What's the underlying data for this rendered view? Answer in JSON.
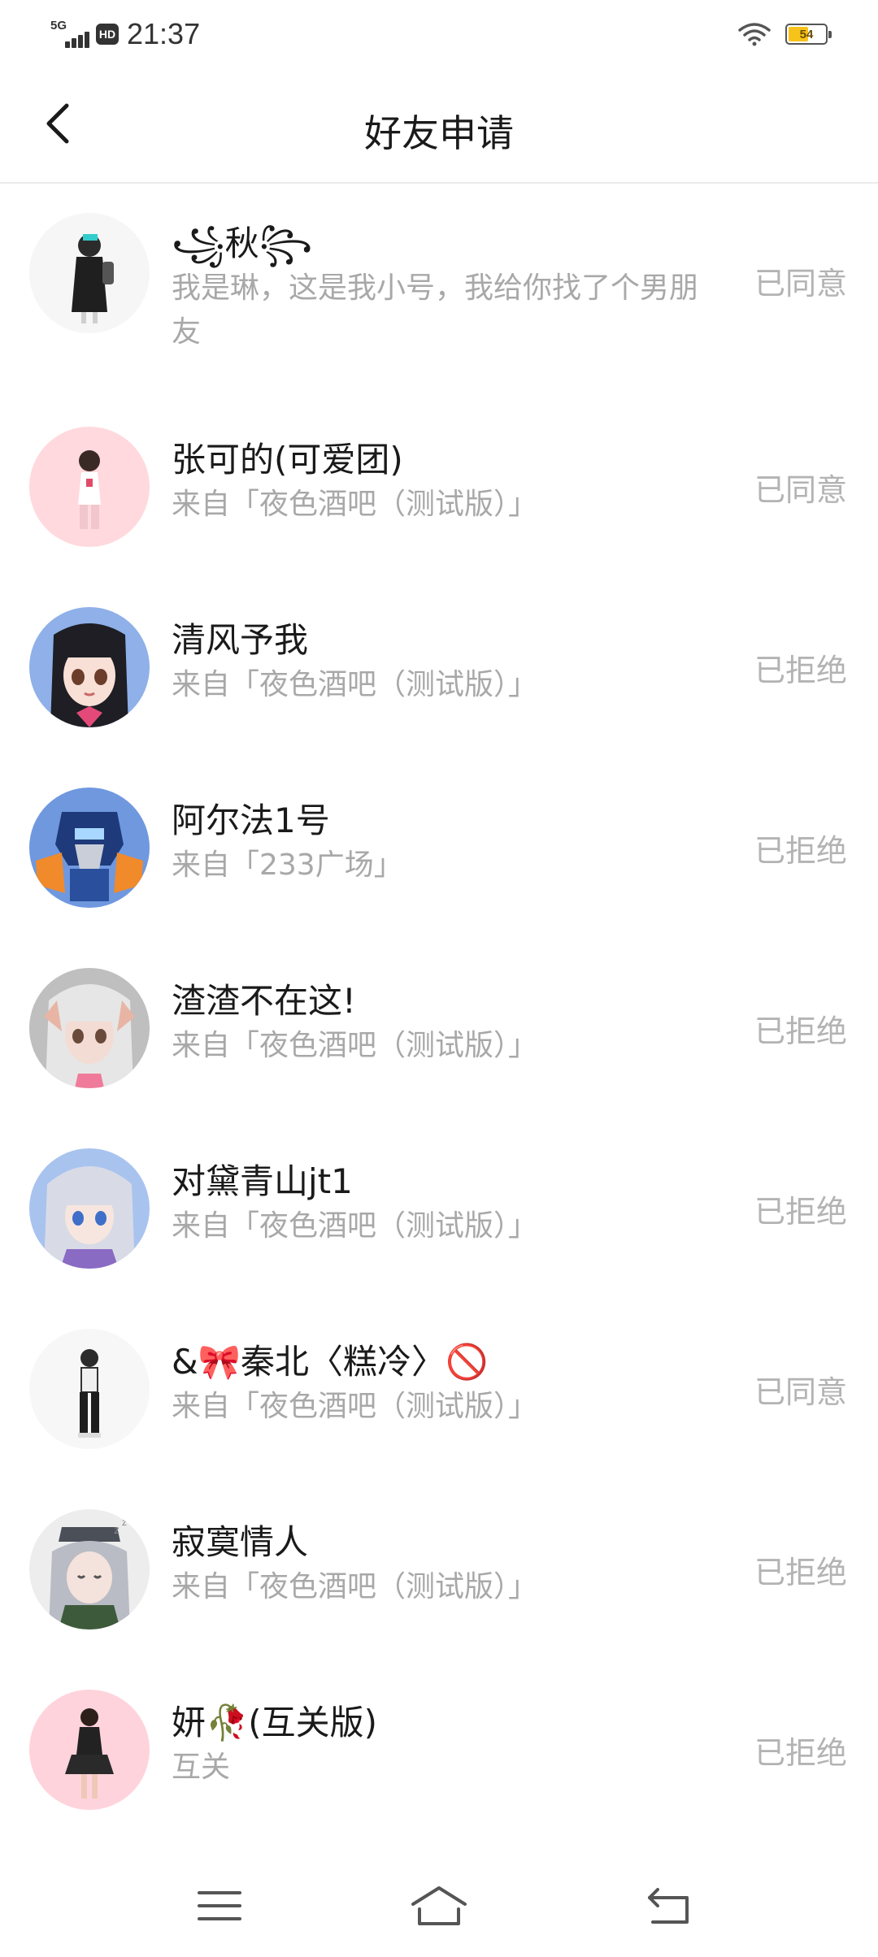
{
  "status_bar": {
    "network": "5G",
    "hd_label": "HD",
    "time": "21:37",
    "battery_level": "54",
    "battery_fraction": 0.54
  },
  "header": {
    "title": "好友申请"
  },
  "requests": [
    {
      "name": "꧁秋꧂",
      "message": "我是琳，这是我小号，我给你找了个男朋友",
      "status": "已同意"
    },
    {
      "name": "张可的(可爱团)",
      "message": "来自「夜色酒吧（测试版）」",
      "status": "已同意"
    },
    {
      "name": "清风予我",
      "message": "来自「夜色酒吧（测试版）」",
      "status": "已拒绝"
    },
    {
      "name": "阿尔法1号",
      "message": "来自「233广场」",
      "status": "已拒绝"
    },
    {
      "name": "渣渣不在这!",
      "message": "来自「夜色酒吧（测试版）」",
      "status": "已拒绝"
    },
    {
      "name": "对黛青山jt1",
      "message": "来自「夜色酒吧（测试版）」",
      "status": "已拒绝"
    },
    {
      "name": "&🎀秦北〈糕冷〉🚫",
      "message": "来自「夜色酒吧（测试版）」",
      "status": "已同意"
    },
    {
      "name": "寂寞情人",
      "message": "来自「夜色酒吧（测试版）」",
      "status": "已拒绝"
    },
    {
      "name": "妍🥀(互关版)",
      "message": "互关",
      "status": "已拒绝"
    }
  ],
  "colors": {
    "status_text": "#b3b3b3",
    "subtitle_text": "#a8a8a8",
    "divider": "#ebebeb"
  },
  "icons": {
    "back": "chevron-left-icon",
    "menu": "menu-icon",
    "home": "home-icon",
    "recent": "back-nav-icon"
  }
}
